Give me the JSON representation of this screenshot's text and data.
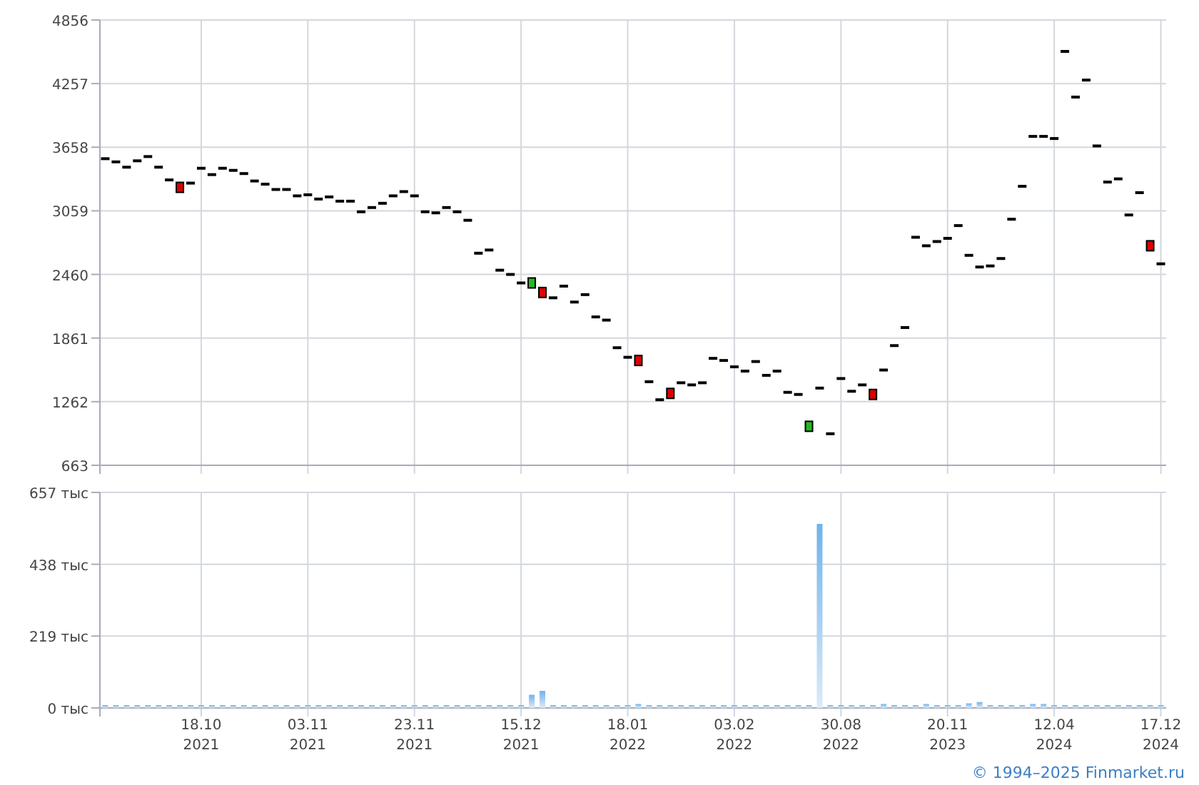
{
  "price_chart": {
    "chart_data": {
      "type": "scatter",
      "grid": true,
      "ylim": [
        663,
        4856
      ],
      "yticks": [
        663,
        1262,
        1861,
        2460,
        3059,
        3658,
        4257,
        4856
      ],
      "series": [
        {
          "color": "#000000",
          "values": [
            3550,
            3520,
            3470,
            3530,
            3570,
            3470,
            3350,
            null,
            3320,
            3460,
            3400,
            3460,
            3440,
            3410,
            3340,
            3310,
            3260,
            3260,
            3200,
            3210,
            3170,
            3190,
            3150,
            3150,
            3050,
            3090,
            3130,
            3200,
            3240,
            3200,
            3050,
            3040,
            3090,
            3050,
            2970,
            2660,
            2690,
            2500,
            2460,
            2380,
            null,
            null,
            2240,
            2350,
            2200,
            2270,
            2060,
            2030,
            1770,
            1680,
            null,
            1450,
            1280,
            null,
            1440,
            1420,
            1440,
            1670,
            1650,
            1590,
            1550,
            1640,
            1510,
            1550,
            1350,
            1330,
            null,
            1390,
            960,
            1480,
            1360,
            1420,
            null,
            1560,
            1790,
            1960,
            2810,
            2730,
            2770,
            2800,
            2920,
            2640,
            2530,
            2540,
            2610,
            2980,
            3290,
            3760,
            3760,
            3740,
            4560,
            4130,
            4290,
            3670,
            3330,
            3360,
            3020,
            3230,
            null,
            2560
          ]
        },
        {
          "color": "#22bb22",
          "values": [
            null,
            null,
            null,
            null,
            null,
            null,
            null,
            null,
            null,
            null,
            null,
            null,
            null,
            null,
            null,
            null,
            null,
            null,
            null,
            null,
            null,
            null,
            null,
            null,
            null,
            null,
            null,
            null,
            null,
            null,
            null,
            null,
            null,
            null,
            null,
            null,
            null,
            null,
            null,
            null,
            2380,
            null,
            null,
            null,
            null,
            null,
            null,
            null,
            null,
            null,
            null,
            null,
            null,
            null,
            null,
            null,
            null,
            null,
            null,
            null,
            null,
            null,
            null,
            null,
            null,
            null,
            1030,
            null,
            null,
            null,
            null,
            null,
            null,
            null,
            null,
            null,
            null,
            null,
            null,
            null,
            null,
            null,
            null,
            null,
            null,
            null,
            null,
            null,
            null,
            null,
            null,
            null,
            null,
            null,
            null,
            null,
            null,
            null,
            null,
            null
          ]
        },
        {
          "color": "#dd0000",
          "values": [
            null,
            null,
            null,
            null,
            null,
            null,
            null,
            3280,
            null,
            null,
            null,
            null,
            null,
            null,
            null,
            null,
            null,
            null,
            null,
            null,
            null,
            null,
            null,
            null,
            null,
            null,
            null,
            null,
            null,
            null,
            null,
            null,
            null,
            null,
            null,
            null,
            null,
            null,
            null,
            null,
            null,
            2290,
            null,
            null,
            null,
            null,
            null,
            null,
            null,
            null,
            1650,
            null,
            null,
            1340,
            null,
            null,
            null,
            null,
            null,
            null,
            null,
            null,
            null,
            null,
            null,
            null,
            null,
            null,
            null,
            null,
            null,
            null,
            1330,
            null,
            null,
            null,
            null,
            null,
            null,
            null,
            null,
            null,
            null,
            null,
            null,
            null,
            null,
            null,
            null,
            null,
            null,
            null,
            null,
            null,
            null,
            null,
            null,
            null,
            2730,
            null
          ]
        }
      ]
    }
  },
  "volume_chart": {
    "chart_data": {
      "type": "bar",
      "grid": true,
      "ylim": [
        0,
        657
      ],
      "yticks": [
        {
          "value": 0,
          "label": "0 тыс"
        },
        {
          "value": 219,
          "label": "219 тыс"
        },
        {
          "value": 438,
          "label": "438 тыс"
        },
        {
          "value": 657,
          "label": "657 тыс"
        }
      ],
      "categories": [
        null,
        null,
        null,
        null,
        null,
        null,
        null,
        null,
        null,
        "18.10 2021",
        null,
        null,
        null,
        null,
        null,
        null,
        null,
        null,
        null,
        "03.11 2021",
        null,
        null,
        null,
        null,
        null,
        null,
        null,
        null,
        null,
        "23.11 2021",
        null,
        null,
        null,
        null,
        null,
        null,
        null,
        null,
        null,
        "15.12 2021",
        null,
        null,
        null,
        null,
        null,
        null,
        null,
        null,
        null,
        "18.01 2022",
        null,
        null,
        null,
        null,
        null,
        null,
        null,
        null,
        null,
        "03.02 2022",
        null,
        null,
        null,
        null,
        null,
        null,
        null,
        null,
        null,
        "30.08 2022",
        null,
        null,
        null,
        null,
        null,
        null,
        null,
        null,
        null,
        "20.11 2023",
        null,
        null,
        null,
        null,
        null,
        null,
        null,
        null,
        null,
        "12.04 2024",
        null,
        null,
        null,
        null,
        null,
        null,
        null,
        null,
        null,
        "17.12 2024"
      ],
      "series": [
        {
          "color": "#6fb3ea",
          "values": [
            8,
            8,
            8,
            8,
            8,
            8,
            8,
            8,
            8,
            8,
            8,
            8,
            8,
            8,
            8,
            8,
            8,
            8,
            8,
            8,
            8,
            8,
            8,
            8,
            8,
            8,
            8,
            8,
            8,
            8,
            8,
            8,
            8,
            8,
            8,
            8,
            8,
            8,
            8,
            8,
            40,
            52,
            8,
            8,
            8,
            8,
            8,
            8,
            8,
            8,
            12,
            8,
            8,
            8,
            8,
            8,
            8,
            8,
            8,
            8,
            8,
            8,
            8,
            8,
            8,
            8,
            8,
            561,
            8,
            8,
            8,
            8,
            8,
            12,
            8,
            8,
            8,
            12,
            8,
            8,
            8,
            14,
            18,
            8,
            8,
            8,
            8,
            12,
            12,
            8,
            8,
            8,
            8,
            8,
            8,
            8,
            8,
            8,
            8,
            8
          ]
        }
      ]
    }
  },
  "footer": {
    "copyright": "© 1994–2025 Finmarket.ru"
  }
}
